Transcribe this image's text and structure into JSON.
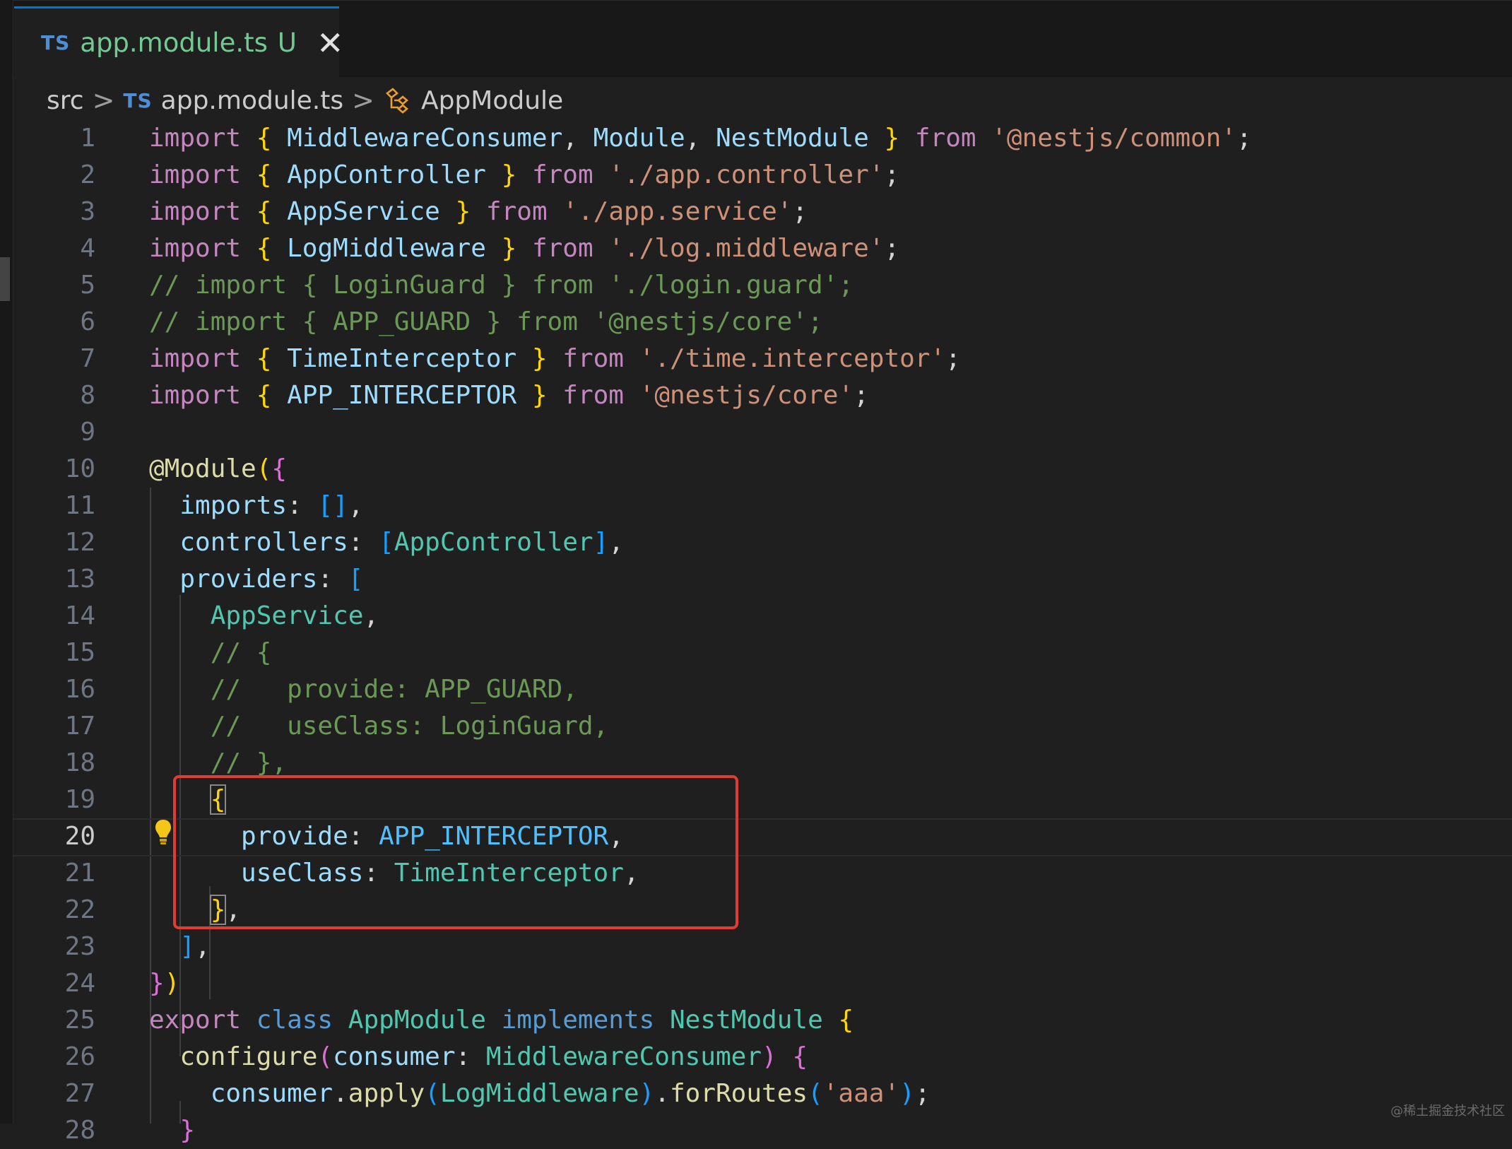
{
  "tab": {
    "badge": "TS",
    "filename": "app.module.ts",
    "status": "U",
    "close_glyph": "✕"
  },
  "breadcrumb": {
    "folder": "src",
    "file_badge": "TS",
    "file": "app.module.ts",
    "symbol": "AppModule",
    "separator": ">"
  },
  "lines": [
    {
      "n": "1"
    },
    {
      "n": "2"
    },
    {
      "n": "3"
    },
    {
      "n": "4"
    },
    {
      "n": "5"
    },
    {
      "n": "6"
    },
    {
      "n": "7"
    },
    {
      "n": "8"
    },
    {
      "n": "9"
    },
    {
      "n": "10"
    },
    {
      "n": "11"
    },
    {
      "n": "12"
    },
    {
      "n": "13"
    },
    {
      "n": "14"
    },
    {
      "n": "15"
    },
    {
      "n": "16"
    },
    {
      "n": "17"
    },
    {
      "n": "18"
    },
    {
      "n": "19"
    },
    {
      "n": "20"
    },
    {
      "n": "21"
    },
    {
      "n": "22"
    },
    {
      "n": "23"
    },
    {
      "n": "24"
    },
    {
      "n": "25"
    },
    {
      "n": "26"
    },
    {
      "n": "27"
    },
    {
      "n": "28"
    }
  ],
  "code": {
    "import": "import",
    "from": "from",
    "brace_open": "{",
    "brace_close": "}",
    "MiddlewareConsumer": "MiddlewareConsumer",
    "Module": "Module",
    "NestModule": "NestModule",
    "AppController": "AppController",
    "AppService": "AppService",
    "LogMiddleware": "LogMiddleware",
    "TimeInterceptor": "TimeInterceptor",
    "APP_INTERCEPTOR": "APP_INTERCEPTOR",
    "s_common": "'@nestjs/common'",
    "s_controller": "'./app.controller'",
    "s_service": "'./app.service'",
    "s_log": "'./log.middleware'",
    "s_time": "'./time.interceptor'",
    "s_core": "'@nestjs/core'",
    "s_aaa": "'aaa'",
    "c5": "// import { LoginGuard } from './login.guard';",
    "c6": "// import { APP_GUARD } from '@nestjs/core';",
    "c15": "// {",
    "c16": "//   provide: APP_GUARD,",
    "c17": "//   useClass: LoginGuard,",
    "c18": "// },",
    "decorator": "@Module",
    "imports": "imports",
    "controllers": "controllers",
    "providers": "providers",
    "provide": "provide",
    "useClass": "useClass",
    "export": "export",
    "class": "class",
    "AppModule": "AppModule",
    "implements": "implements",
    "configure": "configure",
    "consumer": "consumer",
    "apply": "apply",
    "forRoutes": "forRoutes"
  },
  "watermark": "@稀土掘金技术社区",
  "colors": {
    "tab_label": "#73c991",
    "highlight_box": "#e03c31",
    "keyword": "#c586c0",
    "type": "#4ec9b0",
    "string": "#ce9178",
    "comment": "#6a9955"
  }
}
